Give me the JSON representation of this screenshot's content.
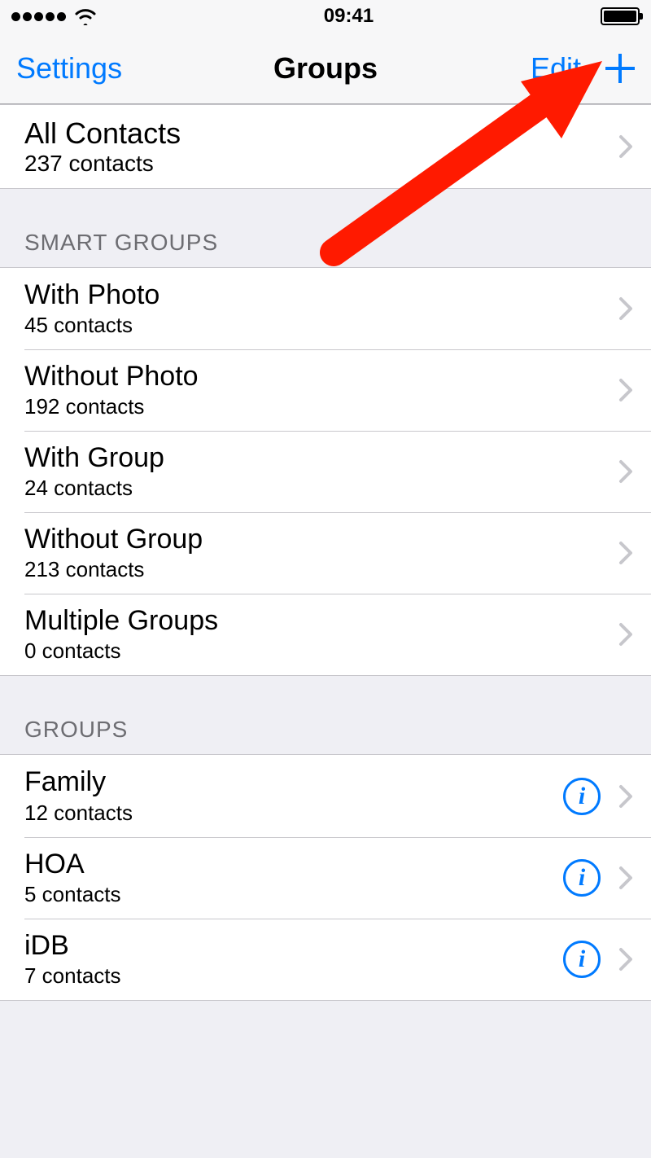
{
  "status_bar": {
    "time": "09:41"
  },
  "nav": {
    "back_label": "Settings",
    "title": "Groups",
    "edit_label": "Edit"
  },
  "all_contacts": {
    "title": "All Contacts",
    "subtitle": "237 contacts"
  },
  "sections": {
    "smart_groups_header": "SMART GROUPS",
    "groups_header": "GROUPS"
  },
  "smart_groups": [
    {
      "title": "With Photo",
      "subtitle": "45 contacts"
    },
    {
      "title": "Without Photo",
      "subtitle": "192 contacts"
    },
    {
      "title": "With Group",
      "subtitle": "24 contacts"
    },
    {
      "title": "Without Group",
      "subtitle": "213 contacts"
    },
    {
      "title": "Multiple Groups",
      "subtitle": "0 contacts"
    }
  ],
  "groups": [
    {
      "title": "Family",
      "subtitle": "12 contacts"
    },
    {
      "title": "HOA",
      "subtitle": "5 contacts"
    },
    {
      "title": "iDB",
      "subtitle": "7 contacts"
    }
  ],
  "colors": {
    "tint": "#007aff",
    "separator": "#c8c7cc",
    "section_bg": "#efeff4",
    "annotation": "#ff1a00"
  }
}
